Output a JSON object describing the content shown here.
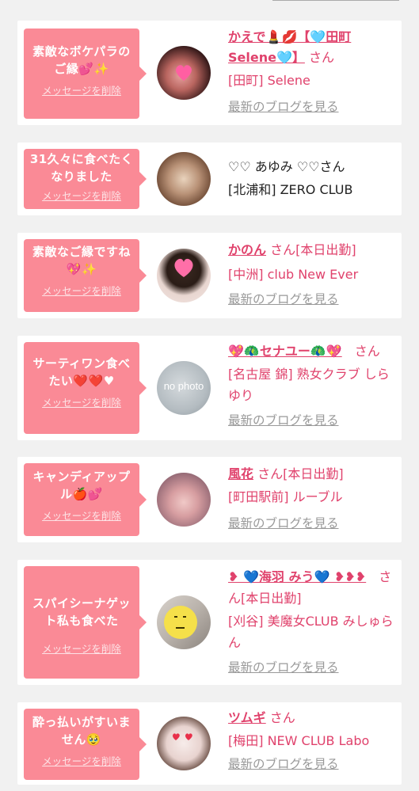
{
  "cards": [
    {
      "message": "素敵なボケパラのご縁💕✨",
      "delete_label": "メッセージを削除",
      "name": "かえで💄💋【🩵田町Selene🩵】",
      "san": "さん",
      "status": "",
      "shop": "[田町] Selene",
      "blog": "最新のブログを見る"
    },
    {
      "message": "31久々に食べたくなりました",
      "delete_label": "メッセージを削除",
      "name": "♡♡ あゆみ ♡♡さん",
      "san": "",
      "status": "",
      "shop": "[北浦和] ZERO CLUB",
      "blog": ""
    },
    {
      "message": "素敵なご縁ですね💖✨",
      "delete_label": "メッセージを削除",
      "name": "かのん",
      "san": "さん",
      "status": "[本日出勤]",
      "shop": "[中洲] club New Ever",
      "blog": "最新のブログを見る"
    },
    {
      "message": "サーティワン食べたい❤️❤️♥",
      "delete_label": "メッセージを削除",
      "name": "💖🦚セナユー🦚💖",
      "san": "さん",
      "status": "",
      "shop": "[名古屋 錦] 熟女クラブ しらゆり",
      "blog": "最新のブログを見る",
      "avatar_text": "no photo"
    },
    {
      "message": "キャンディアップル🍎💕",
      "delete_label": "メッセージを削除",
      "name": "風花",
      "san": "さん",
      "status": "[本日出勤]",
      "shop": "[町田駅前] ルーブル",
      "blog": "最新のブログを見る"
    },
    {
      "message": "スパイシーナゲット私も食べた",
      "delete_label": "メッセージを削除",
      "name": "❥ 💙海羽 みう💙 ❥❥❥",
      "san": "さん",
      "status": "[本日出勤]",
      "shop": "[刈谷] 美魔女CLUB みしゅらん",
      "blog": "最新のブログを見る"
    },
    {
      "message": "酔っ払いがすいません🥹",
      "delete_label": "メッセージを削除",
      "name": "ツムギ",
      "san": "さん",
      "status": "",
      "shop": "[梅田] NEW CLUB Labo",
      "blog": "最新のブログを見る"
    }
  ]
}
